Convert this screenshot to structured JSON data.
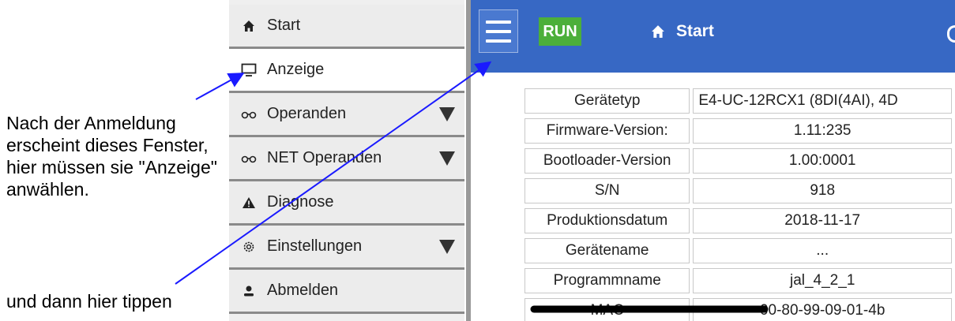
{
  "annotations": {
    "note_top": "Nach der Anmeldung erscheint dieses Fenster, hier müssen sie \"Anzeige\" anwählen.",
    "note_bottom": "und dann hier tippen"
  },
  "sidebar": {
    "items": [
      {
        "label": "Start",
        "icon": "home-icon"
      },
      {
        "label": "Anzeige",
        "icon": "monitor-icon"
      },
      {
        "label": "Operanden",
        "icon": "glasses-icon",
        "expandable": true
      },
      {
        "label": "NET Operanden",
        "icon": "glasses-icon",
        "expandable": true
      },
      {
        "label": "Diagnose",
        "icon": "warning-icon"
      },
      {
        "label": "Einstellungen",
        "icon": "gear-icon",
        "expandable": true
      },
      {
        "label": "Abmelden",
        "icon": "user-icon"
      }
    ]
  },
  "header": {
    "status_badge": "RUN",
    "title": "Start",
    "colors": {
      "bar": "#3768c4",
      "run": "#4caf3a"
    }
  },
  "device_info": {
    "rows": [
      {
        "key": "Gerätetyp",
        "value": "E4-UC-12RCX1 (8DI(4AI), 4D"
      },
      {
        "key": "Firmware-Version:",
        "value": "1.11:235"
      },
      {
        "key": "Bootloader-Version",
        "value": "1.00:0001"
      },
      {
        "key": "S/N",
        "value": "918"
      },
      {
        "key": "Produktionsdatum",
        "value": "2018-11-17"
      },
      {
        "key": "Gerätename",
        "value": "..."
      },
      {
        "key": "Programmname",
        "value": "jal_4_2_1"
      },
      {
        "key": "MAC",
        "value": "00-80-99-09-01-4b"
      }
    ]
  }
}
